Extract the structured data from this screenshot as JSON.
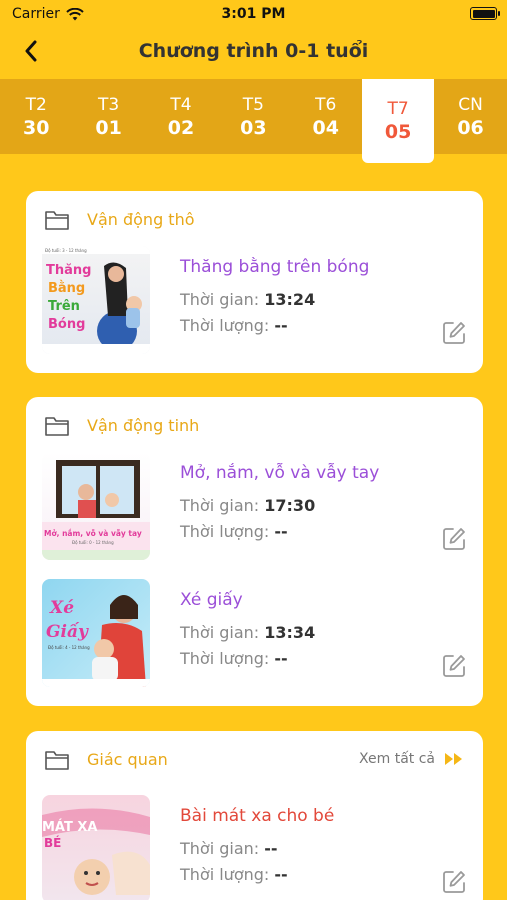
{
  "status_bar": {
    "carrier": "Carrier",
    "time": "3:01 PM"
  },
  "header": {
    "title": "Chương trình 0-1 tuổi"
  },
  "days": [
    {
      "name": "T2",
      "num": "30"
    },
    {
      "name": "T3",
      "num": "01"
    },
    {
      "name": "T4",
      "num": "02"
    },
    {
      "name": "T5",
      "num": "03"
    },
    {
      "name": "T6",
      "num": "04"
    },
    {
      "name": "T7",
      "num": "05"
    },
    {
      "name": "CN",
      "num": "06"
    }
  ],
  "active_day": "T7",
  "sections": [
    {
      "title": "Vận động thô",
      "items": [
        {
          "name": "Thăng bằng trên bóng",
          "time_label": "Thời gian:",
          "time": "13:24",
          "duration_label": "Thời lượng:",
          "duration": "--",
          "thumb_text": [
            "Thăng",
            "Bằng",
            "Trên",
            "Bóng"
          ],
          "thumb_sub": "Độ tuổi: 3 - 12 tháng"
        }
      ]
    },
    {
      "title": "Vận động tinh",
      "items": [
        {
          "name": "Mở, nắm, vỗ và vẫy tay",
          "time_label": "Thời gian:",
          "time": "17:30",
          "duration_label": "Thời lượng:",
          "duration": "--",
          "thumb_text": [
            "Mở, nắm, vỗ và vẫy tay"
          ],
          "thumb_sub": "Độ tuổi: 0 - 12 tháng"
        },
        {
          "name": "Xé giấy",
          "time_label": "Thời gian:",
          "time": "13:34",
          "duration_label": "Thời lượng:",
          "duration": "--",
          "thumb_text": [
            "Xé",
            "Giấy"
          ],
          "thumb_sub": "Độ tuổi: 4 - 12 tháng"
        }
      ]
    },
    {
      "title": "Giác quan",
      "see_all": "Xem tất cả",
      "items": [
        {
          "name": "Bài mát xa cho bé",
          "time_label": "Thời gian:",
          "time": "--",
          "duration_label": "Thời lượng:",
          "duration": "--",
          "thumb_text": [
            "MÁT XA",
            "BÉ"
          ],
          "thumb_sub": ""
        }
      ]
    }
  ],
  "colors": {
    "background": "#FFC81A",
    "tab_bar": "#E3A617",
    "active_day": "#F0583A",
    "section_title": "#E8A818",
    "item_title": "#9B4FD8",
    "item_title_alt": "#E2483A"
  },
  "icons": {
    "back": "chevron-left-icon",
    "folder": "folder-icon",
    "edit": "edit-icon",
    "see_all": "double-chevron-right-icon"
  }
}
